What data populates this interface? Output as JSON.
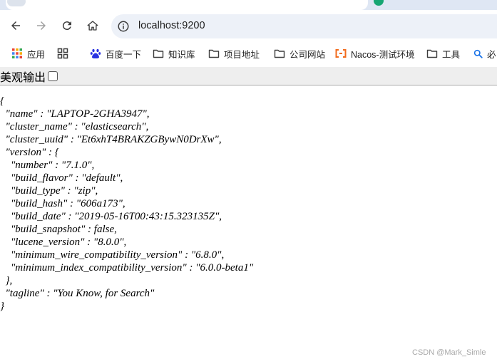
{
  "browser": {
    "url": "localhost:9200",
    "colors": {
      "omnibox_bg": "#edf1f8",
      "tabstrip_bg": "#dfe7f4",
      "ext_icon": "#17a673"
    },
    "icons": [
      "back-arrow-icon",
      "forward-arrow-icon",
      "reload-icon",
      "home-icon",
      "site-info-icon"
    ]
  },
  "bookmarks": [
    {
      "label": "应用",
      "icon": "apps-grid-icon"
    },
    {
      "label": "",
      "icon": "grid-icon"
    },
    {
      "label": "百度一下",
      "icon": "baidu-paw-icon"
    },
    {
      "label": "知识库",
      "icon": "folder-icon"
    },
    {
      "label": "项目地址",
      "icon": "folder-icon"
    },
    {
      "label": "公司网站",
      "icon": "folder-icon"
    },
    {
      "label": "Nacos-测试环境",
      "icon": "nacos-icon"
    },
    {
      "label": "工具",
      "icon": "folder-icon"
    },
    {
      "label": "必",
      "icon": "search-icon"
    }
  ],
  "pretty_print": {
    "label": "美观输出",
    "checked": false
  },
  "json_lines": [
    "{",
    "  \"name\" : \"LAPTOP-2GHA3947\",",
    "  \"cluster_name\" : \"elasticsearch\",",
    "  \"cluster_uuid\" : \"Et6xhT4BRAKZGBywN0DrXw\",",
    "  \"version\" : {",
    "    \"number\" : \"7.1.0\",",
    "    \"build_flavor\" : \"default\",",
    "    \"build_type\" : \"zip\",",
    "    \"build_hash\" : \"606a173\",",
    "    \"build_date\" : \"2019-05-16T00:43:15.323135Z\",",
    "    \"build_snapshot\" : false,",
    "    \"lucene_version\" : \"8.0.0\",",
    "    \"minimum_wire_compatibility_version\" : \"6.8.0\",",
    "    \"minimum_index_compatibility_version\" : \"6.0.0-beta1\"",
    "  },",
    "  \"tagline\" : \"You Know, for Search\"",
    "}"
  ],
  "watermark": "CSDN @Mark_Simle"
}
